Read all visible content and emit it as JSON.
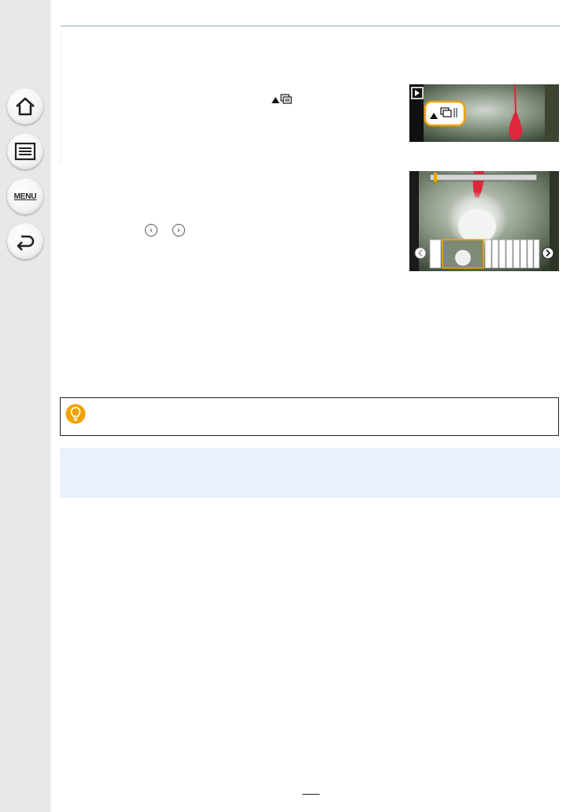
{
  "sidebar": {
    "home_button": "home",
    "contents_button": "contents",
    "menu_label": "MENU",
    "back_button": "back"
  },
  "footer": {
    "page_number": ""
  },
  "icons": {
    "burst_icon": "burst-playback-icon",
    "prev_icon": "chevron-left-icon",
    "next_icon": "chevron-right-icon",
    "tip_icon": "lightbulb-icon"
  },
  "colors": {
    "highlight_orange": "#f2a100",
    "note_band": "#eaf1fc",
    "rule_blue": "#c7d1e6"
  }
}
